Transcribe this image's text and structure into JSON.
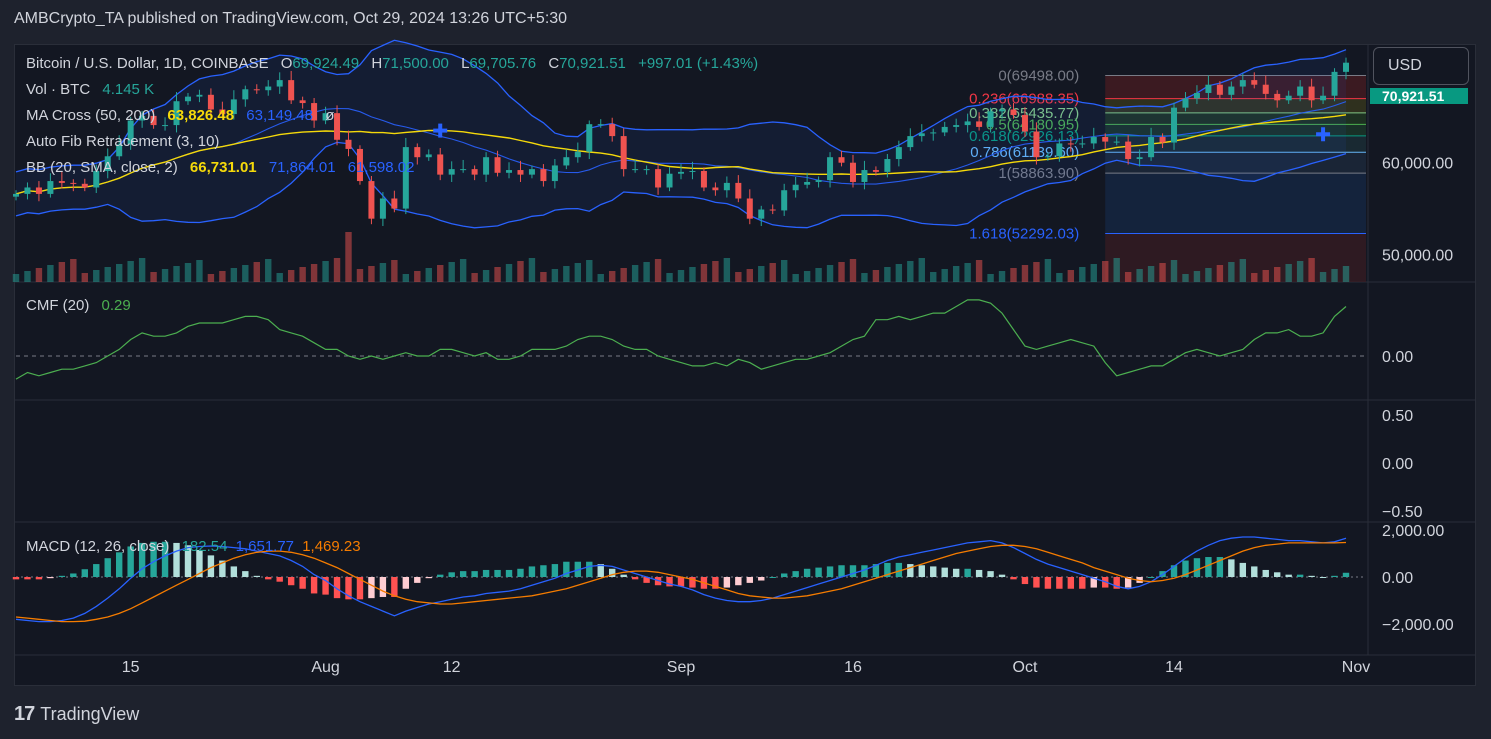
{
  "header": {
    "published": "AMBCrypto_TA published on TradingView.com, Oct 29, 2024 13:26 UTC+5:30"
  },
  "currency_button": "USD",
  "price_tag": "70,921.51",
  "footer": {
    "brand": "TradingView"
  },
  "legend": {
    "symbol": "Bitcoin / U.S. Dollar, 1D, COINBASE",
    "open_label": "O",
    "open": "69,924.49",
    "high_label": "H",
    "high": "71,500.00",
    "low_label": "L",
    "low": "69,705.76",
    "close_label": "C",
    "close": "70,921.51",
    "change": "+997.01 (+1.43%)",
    "vol_label": "Vol · BTC",
    "vol": "4.145 K",
    "ma_label": "MA Cross (50, 200)",
    "ma50": "63,826.48",
    "ma200": "63,149.48",
    "fib_label": "Auto Fib Retracement (3, 10)",
    "bb_label": "BB (20, SMA, close, 2)",
    "bb_basis": "66,731.01",
    "bb_upper": "71,864.01",
    "bb_lower": "61,598.02",
    "cmf_label": "CMF (20)",
    "cmf": "0.29",
    "macd_label": "MACD (12, 26, close)",
    "macd_hist": "182.54",
    "macd": "1,651.77",
    "macd_signal": "1,469.23"
  },
  "fib_levels": [
    {
      "label": "0(69498.00)",
      "value": 69498.0,
      "color": "#787b86"
    },
    {
      "label": "0.236(66988.35)",
      "value": 66988.35,
      "color": "#f23645"
    },
    {
      "label": "0.382(65435.77)",
      "value": 65435.77,
      "color": "#81c784"
    },
    {
      "label": "0.5(64180.95)",
      "value": 64180.95,
      "color": "#4caf50"
    },
    {
      "label": "0.618(62926.13)",
      "value": 62926.13,
      "color": "#089981"
    },
    {
      "label": "0.786(61139.60)",
      "value": 61139.6,
      "color": "#64b5f6"
    },
    {
      "label": "1(58863.90)",
      "value": 58863.9,
      "color": "#787b86"
    },
    {
      "label": "1.618(52292.03)",
      "value": 52292.03,
      "color": "#2962ff"
    }
  ],
  "price_axis": {
    "ticks": [
      {
        "v": 60000,
        "label": "60,000.00"
      },
      {
        "v": 50000,
        "label": "50,000.00"
      }
    ],
    "range": [
      47000,
      72500
    ]
  },
  "cmf_axis": {
    "ticks": [
      {
        "v": 0,
        "label": "0.00"
      }
    ]
  },
  "empty_axis": {
    "ticks": [
      {
        "v": 0.5,
        "label": "0.50"
      },
      {
        "v": 0,
        "label": "0.00"
      },
      {
        "v": -0.5,
        "label": "−0.50"
      }
    ]
  },
  "macd_axis": {
    "ticks": [
      {
        "v": 2000,
        "label": "2,000.00"
      },
      {
        "v": 0,
        "label": "0.00"
      },
      {
        "v": -2000,
        "label": "−2,000.00"
      }
    ]
  },
  "time_axis": [
    {
      "label": "15",
      "idx": 10
    },
    {
      "label": "Aug",
      "idx": 27
    },
    {
      "label": "12",
      "idx": 38
    },
    {
      "label": "Sep",
      "idx": 58
    },
    {
      "label": "16",
      "idx": 73
    },
    {
      "label": "Oct",
      "idx": 88
    },
    {
      "label": "14",
      "idx": 101
    },
    {
      "label": "Nov",
      "idx": 119
    }
  ],
  "colors": {
    "up": "#26a69a",
    "down": "#ef5350",
    "bb": "#2962ff",
    "ma": "#f5d90a",
    "cmf": "#4caf50",
    "macd": "#2962ff",
    "signal": "#f57c00"
  },
  "chart_data": {
    "type": "candlestick",
    "title": "Bitcoin / U.S. Dollar, 1D, COINBASE",
    "dates_start": "2024-07-05",
    "closes": [
      56600,
      57300,
      56600,
      58000,
      57800,
      57700,
      57300,
      59100,
      60700,
      62000,
      64600,
      65100,
      64100,
      64100,
      66700,
      67200,
      67400,
      65800,
      65300,
      66900,
      68000,
      67900,
      68300,
      69000,
      66800,
      66500,
      64600,
      65400,
      62500,
      61500,
      58000,
      53900,
      56100,
      55000,
      61700,
      60600,
      60900,
      58700,
      59300,
      59300,
      58700,
      60600,
      58900,
      59200,
      58700,
      59300,
      58000,
      59700,
      60600,
      61200,
      64200,
      64200,
      62900,
      59300,
      59300,
      59300,
      57300,
      58800,
      59000,
      59100,
      57300,
      57000,
      57800,
      56100,
      53900,
      54900,
      54800,
      57000,
      57600,
      57900,
      58100,
      60600,
      60000,
      57900,
      59200,
      59000,
      60400,
      61700,
      62900,
      63200,
      63300,
      63900,
      64100,
      64500,
      63900,
      65600,
      65800,
      65200,
      63400,
      60600,
      60700,
      62100,
      62000,
      62100,
      62800,
      62300,
      62300,
      60400,
      60600,
      62800,
      62200,
      66000,
      67000,
      67600,
      68500,
      67400,
      68300,
      69000,
      68500,
      67500,
      66800,
      67300,
      68300,
      66800,
      67300,
      69900,
      70900
    ],
    "cmf": [
      -0.07,
      -0.05,
      -0.06,
      -0.05,
      -0.04,
      -0.04,
      -0.03,
      -0.02,
      0.0,
      0.02,
      0.05,
      0.07,
      0.06,
      0.06,
      0.07,
      0.09,
      0.1,
      0.1,
      0.1,
      0.11,
      0.12,
      0.12,
      0.11,
      0.08,
      0.07,
      0.06,
      0.04,
      0.02,
      0.02,
      0.0,
      -0.01,
      0.0,
      -0.01,
      0.0,
      0.01,
      0.0,
      0.0,
      0.02,
      0.02,
      0.01,
      0.0,
      0.01,
      -0.01,
      -0.01,
      0.0,
      0.02,
      0.02,
      0.02,
      0.03,
      0.05,
      0.06,
      0.06,
      0.05,
      0.03,
      0.02,
      0.02,
      0.0,
      -0.01,
      -0.02,
      -0.03,
      -0.03,
      -0.02,
      -0.03,
      -0.01,
      -0.02,
      -0.04,
      -0.03,
      -0.02,
      -0.01,
      -0.01,
      0.0,
      0.01,
      0.03,
      0.05,
      0.06,
      0.11,
      0.11,
      0.12,
      0.11,
      0.12,
      0.13,
      0.13,
      0.15,
      0.17,
      0.17,
      0.16,
      0.13,
      0.08,
      0.03,
      0.02,
      0.03,
      0.04,
      0.05,
      0.04,
      0.03,
      -0.02,
      -0.06,
      -0.05,
      -0.04,
      -0.03,
      -0.03,
      -0.01,
      0.01,
      0.02,
      0.01,
      0.0,
      0.01,
      0.02,
      0.05,
      0.07,
      0.07,
      0.08,
      0.06,
      0.06,
      0.07,
      0.12,
      0.15
    ],
    "macd": [
      -1800,
      -1850,
      -1900,
      -1900,
      -1850,
      -1750,
      -1550,
      -1250,
      -900,
      -500,
      -50,
      350,
      650,
      900,
      1100,
      1250,
      1300,
      1320,
      1300,
      1250,
      1200,
      1100,
      1000,
      900,
      700,
      450,
      100,
      -150,
      -500,
      -800,
      -1050,
      -1250,
      -1450,
      -1650,
      -1450,
      -1300,
      -1150,
      -1050,
      -950,
      -850,
      -800,
      -700,
      -650,
      -600,
      -500,
      -350,
      -200,
      -50,
      150,
      300,
      450,
      500,
      450,
      300,
      150,
      0,
      -150,
      -300,
      -400,
      -550,
      -750,
      -900,
      -1000,
      -1050,
      -1050,
      -1000,
      -900,
      -750,
      -600,
      -450,
      -300,
      -150,
      0,
      150,
      300,
      500,
      700,
      850,
      950,
      1050,
      1150,
      1250,
      1350,
      1450,
      1500,
      1550,
      1450,
      1250,
      1000,
      750,
      550,
      400,
      250,
      100,
      -50,
      -200,
      -400,
      -500,
      -400,
      -200,
      100,
      450,
      800,
      1100,
      1350,
      1550,
      1650,
      1700,
      1700,
      1650,
      1600,
      1550,
      1550,
      1500,
      1450,
      1500,
      1650
    ],
    "signal": [
      -1700,
      -1750,
      -1800,
      -1850,
      -1900,
      -1900,
      -1880,
      -1800,
      -1700,
      -1550,
      -1350,
      -1100,
      -850,
      -600,
      -350,
      -100,
      150,
      400,
      600,
      800,
      950,
      1050,
      1100,
      1100,
      1050,
      950,
      800,
      600,
      400,
      150,
      -100,
      -350,
      -600,
      -800,
      -950,
      -1050,
      -1100,
      -1150,
      -1150,
      -1100,
      -1050,
      -1000,
      -950,
      -900,
      -850,
      -800,
      -700,
      -600,
      -500,
      -350,
      -200,
      -50,
      100,
      200,
      250,
      250,
      200,
      100,
      0,
      -100,
      -250,
      -400,
      -550,
      -700,
      -800,
      -850,
      -900,
      -900,
      -850,
      -800,
      -700,
      -600,
      -500,
      -350,
      -200,
      -50,
      100,
      250,
      400,
      550,
      700,
      850,
      1000,
      1100,
      1200,
      1300,
      1350,
      1350,
      1300,
      1200,
      1050,
      900,
      750,
      600,
      400,
      250,
      100,
      -50,
      -150,
      -200,
      -150,
      -50,
      100,
      300,
      500,
      700,
      900,
      1100,
      1250,
      1350,
      1400,
      1450,
      1450,
      1450,
      1450,
      1450,
      1470
    ]
  }
}
